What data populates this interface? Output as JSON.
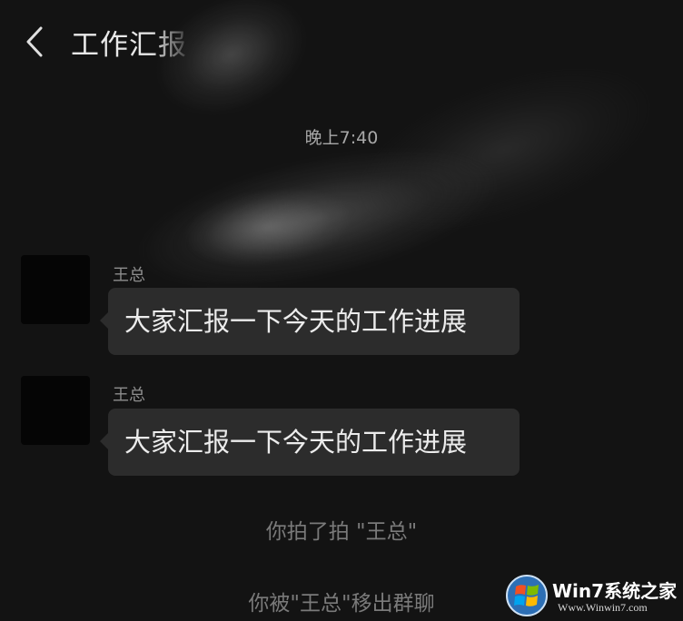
{
  "header": {
    "title": "工作汇报"
  },
  "timestamp": "晚上7:40",
  "messages": [
    {
      "sender": "王总",
      "text": "大家汇报一下今天的工作进展"
    },
    {
      "sender": "王总",
      "text": "大家汇报一下今天的工作进展"
    }
  ],
  "system_messages": [
    "你拍了拍 \"王总\"",
    "你被\"王总\"移出群聊"
  ],
  "watermark": {
    "brand": "Win7系统之家",
    "url": "Www.Winwin7.com"
  },
  "colors": {
    "background": "#131313",
    "bubble": "#2c2c2c",
    "bubble_text": "#ececec",
    "system_text": "#7a7a7a"
  },
  "icons": {
    "back": "chevron-left-icon",
    "logo": "windows-logo-icon"
  }
}
